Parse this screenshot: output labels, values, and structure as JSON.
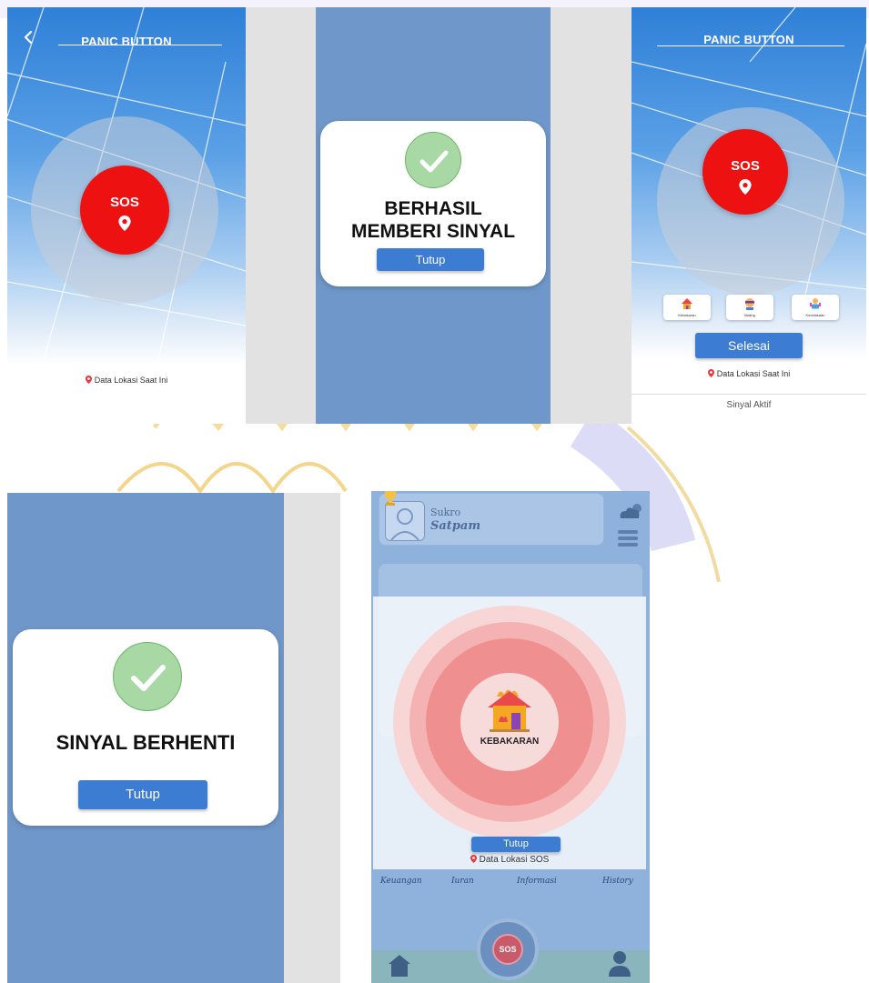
{
  "screens": {
    "panic_a": {
      "title": "PANIC BUTTON",
      "sos_label": "SOS",
      "location_label": "Data Lokasi Saat Ini"
    },
    "success_dialog": {
      "title": "BERHASIL MEMBERI SINYAL",
      "close_label": "Tutup"
    },
    "panic_b": {
      "title": "PANIC BUTTON",
      "sos_label": "SOS",
      "categories": [
        {
          "label": "Kebakaran",
          "icon": "house-fire-icon"
        },
        {
          "label": "Maling",
          "icon": "thief-icon"
        },
        {
          "label": "Kecelakaan",
          "icon": "help-person-icon"
        }
      ],
      "finish_label": "Selesai",
      "location_label": "Data Lokasi Saat Ini",
      "status_label": "Sinyal Aktif"
    },
    "stopped_dialog": {
      "title": "SINYAL BERHENTI",
      "close_label": "Tutup"
    },
    "home_alert": {
      "user_name": "Sukro",
      "user_role": "Satpam",
      "alert_label": "KEBAKARAN",
      "close_label": "Tutup",
      "location_label": "Data Lokasi SOS",
      "nav_items": [
        "Keuangan",
        "Iuran",
        "Informasi",
        "History"
      ],
      "sos_label": "SOS"
    }
  },
  "colors": {
    "sos_red": "#ee1111",
    "button_blue": "#3c7dd3",
    "overlay_blue": "#7097c9",
    "check_green": "#a8d8a4"
  }
}
